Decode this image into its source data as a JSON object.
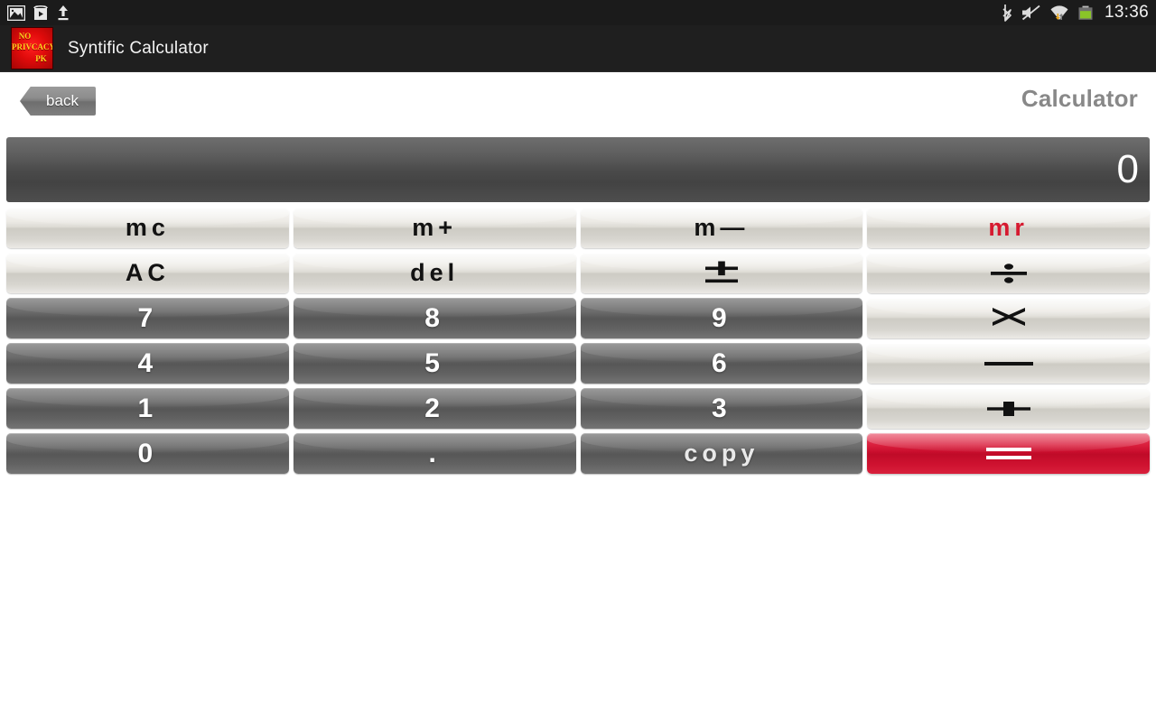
{
  "statusbar": {
    "time": "13:36",
    "left_icons": [
      "image-icon",
      "play-store-icon",
      "upload-icon"
    ],
    "right_icons": [
      "bluetooth-icon",
      "volume-mute-icon",
      "wifi-icon",
      "battery-icon"
    ]
  },
  "titlebar": {
    "app_name": "Syntific Calculator",
    "icon_line1": "NO",
    "icon_line2": "PRIVCACY",
    "icon_line3": "PK"
  },
  "nav": {
    "back_label": "back",
    "page_title": "Calculator"
  },
  "display": {
    "value": "0"
  },
  "colors": {
    "accent_red": "#c80d2c",
    "mr_red": "#d6192f",
    "display_bg": "#4a4a4a",
    "title_gray": "#888888"
  },
  "keypad": {
    "rows": [
      [
        {
          "label": "mc",
          "name": "memory-clear-button",
          "style": "light"
        },
        {
          "label": "m+",
          "name": "memory-add-button",
          "style": "light"
        },
        {
          "label": "m—",
          "name": "memory-subtract-button",
          "style": "light"
        },
        {
          "label": "mr",
          "name": "memory-recall-button",
          "style": "light-red-text"
        }
      ],
      [
        {
          "label": "AC",
          "name": "all-clear-button",
          "style": "light"
        },
        {
          "label": "del",
          "name": "delete-button",
          "style": "light"
        },
        {
          "label": "±",
          "name": "plus-minus-button",
          "style": "light-glyph"
        },
        {
          "label": "÷",
          "name": "divide-button",
          "style": "light-glyph"
        }
      ],
      [
        {
          "label": "7",
          "name": "digit-7-button",
          "style": "dark"
        },
        {
          "label": "8",
          "name": "digit-8-button",
          "style": "dark"
        },
        {
          "label": "9",
          "name": "digit-9-button",
          "style": "dark"
        },
        {
          "label": "×",
          "name": "multiply-button",
          "style": "light-glyph"
        }
      ],
      [
        {
          "label": "4",
          "name": "digit-4-button",
          "style": "dark"
        },
        {
          "label": "5",
          "name": "digit-5-button",
          "style": "dark"
        },
        {
          "label": "6",
          "name": "digit-6-button",
          "style": "dark"
        },
        {
          "label": "—",
          "name": "subtract-button",
          "style": "light-glyph"
        }
      ],
      [
        {
          "label": "1",
          "name": "digit-1-button",
          "style": "dark"
        },
        {
          "label": "2",
          "name": "digit-2-button",
          "style": "dark"
        },
        {
          "label": "3",
          "name": "digit-3-button",
          "style": "dark"
        },
        {
          "label": "+",
          "name": "add-button",
          "style": "light-glyph"
        }
      ],
      [
        {
          "label": "0",
          "name": "digit-0-button",
          "style": "dark"
        },
        {
          "label": ".",
          "name": "decimal-point-button",
          "style": "dark"
        },
        {
          "label": "copy",
          "name": "copy-button",
          "style": "dark-word"
        },
        {
          "label": "=",
          "name": "equals-button",
          "style": "red"
        }
      ]
    ]
  }
}
